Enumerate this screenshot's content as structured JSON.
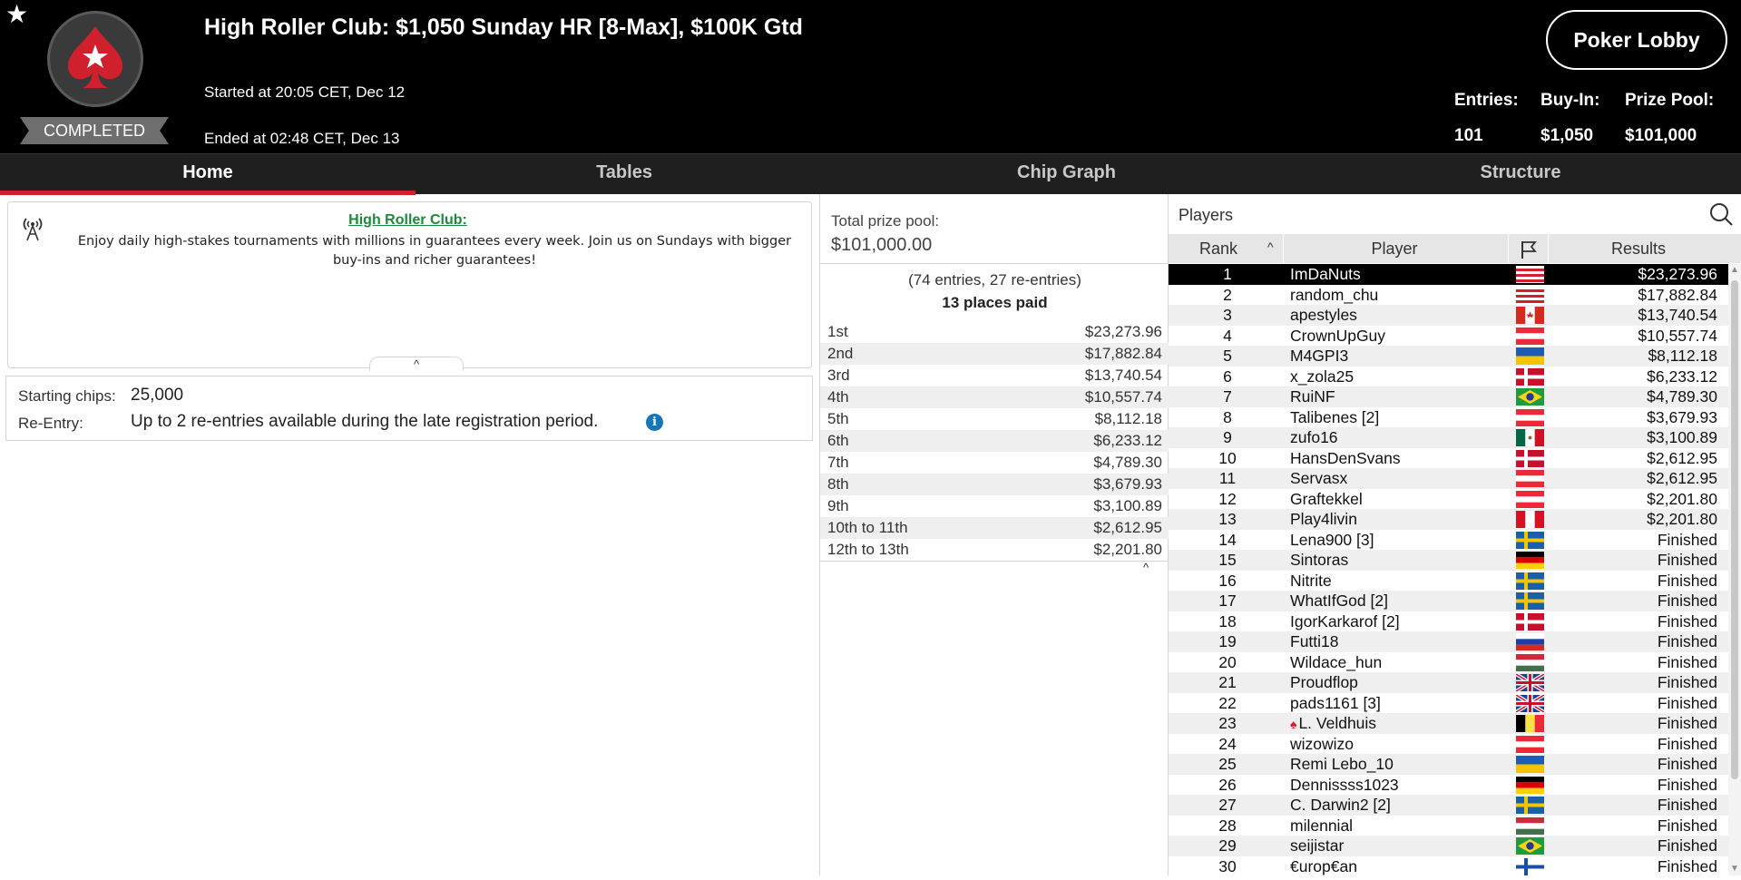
{
  "header": {
    "title": "High Roller Club: $1,050 Sunday HR [8-Max], $100K Gtd",
    "started": "Started at 20:05 CET, Dec 12",
    "ended": "Ended at 02:48 CET, Dec 13",
    "status": "COMPLETED",
    "lobby_button": "Poker Lobby",
    "stats": [
      {
        "label": "Entries:",
        "value": "101"
      },
      {
        "label": "Buy-In:",
        "value": "$1,050"
      },
      {
        "label": "Prize Pool:",
        "value": "$101,000"
      }
    ],
    "icons": {
      "favorite": "star-icon",
      "logo": "pokerstars-spade-logo"
    }
  },
  "tabs": [
    {
      "label": "Home",
      "active": true
    },
    {
      "label": "Tables",
      "active": false
    },
    {
      "label": "Chip Graph",
      "active": false
    },
    {
      "label": "Structure",
      "active": false
    }
  ],
  "info": {
    "title": "High Roller Club:",
    "text": "Enjoy daily high-stakes tournaments with millions in guarantees every week. Join us on Sundays with bigger buy-ins and richer guarantees!",
    "collapse": "^"
  },
  "details": {
    "starting_chips_label": "Starting chips:",
    "starting_chips_value": "25,000",
    "reentry_label": "Re-Entry:",
    "reentry_value": "Up to 2 re-entries available during the late registration period.",
    "info_icon": "i"
  },
  "prize": {
    "label": "Total prize pool:",
    "value": "$101,000.00",
    "entries": "(74 entries, 27 re-entries)",
    "paid": "13 places paid",
    "collapse": "^",
    "payouts": [
      {
        "place": "1st",
        "amount": "$23,273.96"
      },
      {
        "place": "2nd",
        "amount": "$17,882.84"
      },
      {
        "place": "3rd",
        "amount": "$13,740.54"
      },
      {
        "place": "4th",
        "amount": "$10,557.74"
      },
      {
        "place": "5th",
        "amount": "$8,112.18"
      },
      {
        "place": "6th",
        "amount": "$6,233.12"
      },
      {
        "place": "7th",
        "amount": "$4,789.30"
      },
      {
        "place": "8th",
        "amount": "$3,679.93"
      },
      {
        "place": "9th",
        "amount": "$3,100.89"
      },
      {
        "place": "10th to 11th",
        "amount": "$2,612.95"
      },
      {
        "place": "12th to 13th",
        "amount": "$2,201.80"
      }
    ]
  },
  "players": {
    "title": "Players",
    "columns": {
      "rank": "Rank",
      "player": "Player",
      "results": "Results"
    },
    "colors": {
      "selected_bg": "#000000",
      "alt_row": "#efefef",
      "accent_red": "#d0202e"
    },
    "rows": [
      {
        "rank": "1",
        "name": "ImDaNuts",
        "flag": "red-white",
        "result": "$23,273.96"
      },
      {
        "rank": "2",
        "name": "random_chu",
        "flag": "red-white",
        "result": "$17,882.84"
      },
      {
        "rank": "3",
        "name": "apestyles",
        "flag": "canada",
        "result": "$13,740.54"
      },
      {
        "rank": "4",
        "name": "CrownUpGuy",
        "flag": "austria",
        "result": "$10,557.74"
      },
      {
        "rank": "5",
        "name": "M4GPI3",
        "flag": "blue-yellow",
        "result": "$8,112.18"
      },
      {
        "rank": "6",
        "name": "x_zola25",
        "flag": "denmark",
        "result": "$6,233.12"
      },
      {
        "rank": "7",
        "name": "RuiNF",
        "flag": "brazil",
        "result": "$4,789.30"
      },
      {
        "rank": "8",
        "name": "Talibenes [2]",
        "flag": "austria",
        "result": "$3,679.93"
      },
      {
        "rank": "9",
        "name": "zufo16",
        "flag": "mexico",
        "result": "$3,100.89"
      },
      {
        "rank": "10",
        "name": "HansDenSvans",
        "flag": "denmark",
        "result": "$2,612.95"
      },
      {
        "rank": "11",
        "name": "Servasx",
        "flag": "austria",
        "result": "$2,612.95"
      },
      {
        "rank": "12",
        "name": "Graftekkel",
        "flag": "austria",
        "result": "$2,201.80"
      },
      {
        "rank": "13",
        "name": "Play4livin",
        "flag": "peru",
        "result": "$2,201.80"
      },
      {
        "rank": "14",
        "name": "Lena900 [3]",
        "flag": "sweden",
        "result": "Finished"
      },
      {
        "rank": "15",
        "name": "Sintoras",
        "flag": "germany",
        "result": "Finished"
      },
      {
        "rank": "16",
        "name": "Nitrite",
        "flag": "sweden",
        "result": "Finished"
      },
      {
        "rank": "17",
        "name": "WhatIfGod [2]",
        "flag": "sweden",
        "result": "Finished"
      },
      {
        "rank": "18",
        "name": "IgorKarkarof [2]",
        "flag": "denmark",
        "result": "Finished"
      },
      {
        "rank": "19",
        "name": "Futti18",
        "flag": "russia",
        "result": "Finished"
      },
      {
        "rank": "20",
        "name": "Wildace_hun",
        "flag": "hungary",
        "result": "Finished"
      },
      {
        "rank": "21",
        "name": "Proudflop",
        "flag": "uk",
        "result": "Finished"
      },
      {
        "rank": "22",
        "name": "pads1161 [3]",
        "flag": "uk",
        "result": "Finished"
      },
      {
        "rank": "23",
        "name": "L. Veldhuis",
        "flag": "belgium",
        "result": "Finished",
        "pro": true
      },
      {
        "rank": "24",
        "name": "wizowizo",
        "flag": "austria",
        "result": "Finished"
      },
      {
        "rank": "25",
        "name": "Remi Lebo_10",
        "flag": "blue-yellow",
        "result": "Finished"
      },
      {
        "rank": "26",
        "name": "Dennissss1023",
        "flag": "germany",
        "result": "Finished"
      },
      {
        "rank": "27",
        "name": "C. Darwin2 [2]",
        "flag": "sweden",
        "result": "Finished"
      },
      {
        "rank": "28",
        "name": "milennial",
        "flag": "hungary",
        "result": "Finished"
      },
      {
        "rank": "29",
        "name": "seijistar",
        "flag": "brazil",
        "result": "Finished"
      },
      {
        "rank": "30",
        "name": "€urop€an",
        "flag": "finland",
        "result": "Finished"
      }
    ]
  }
}
